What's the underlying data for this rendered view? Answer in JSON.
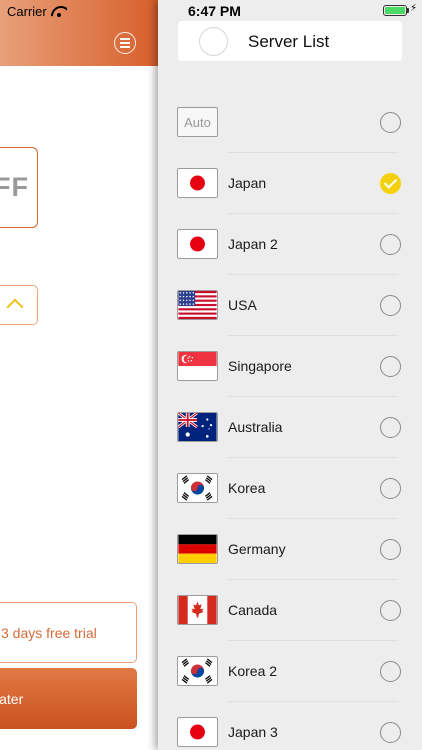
{
  "status_bar": {
    "carrier": "Carrier",
    "time": "6:47 PM",
    "wifi_icon": "wifi-icon",
    "battery_icon": "battery-icon",
    "battery_level": 1.0
  },
  "behind_panel": {
    "menu_icon": "menu-icon",
    "power_text": "FF",
    "trial_text": "3 days free trial",
    "later_text": "later",
    "colors": {
      "accent": "#d7602c",
      "chevron": "#f1c11b"
    }
  },
  "server_list": {
    "title": "Server List",
    "selected_index": 1,
    "colors": {
      "selected": "#f5d10d",
      "panel": "#ededed"
    },
    "items": [
      {
        "label": "",
        "flag": "auto",
        "auto_text": "Auto"
      },
      {
        "label": "Japan",
        "flag": "japan"
      },
      {
        "label": "Japan 2",
        "flag": "japan"
      },
      {
        "label": "USA",
        "flag": "usa"
      },
      {
        "label": "Singapore",
        "flag": "singapore"
      },
      {
        "label": "Australia",
        "flag": "australia"
      },
      {
        "label": "Korea",
        "flag": "korea"
      },
      {
        "label": "Germany",
        "flag": "germany"
      },
      {
        "label": "Canada",
        "flag": "canada"
      },
      {
        "label": "Korea 2",
        "flag": "korea"
      },
      {
        "label": "Japan 3",
        "flag": "japan"
      }
    ]
  }
}
